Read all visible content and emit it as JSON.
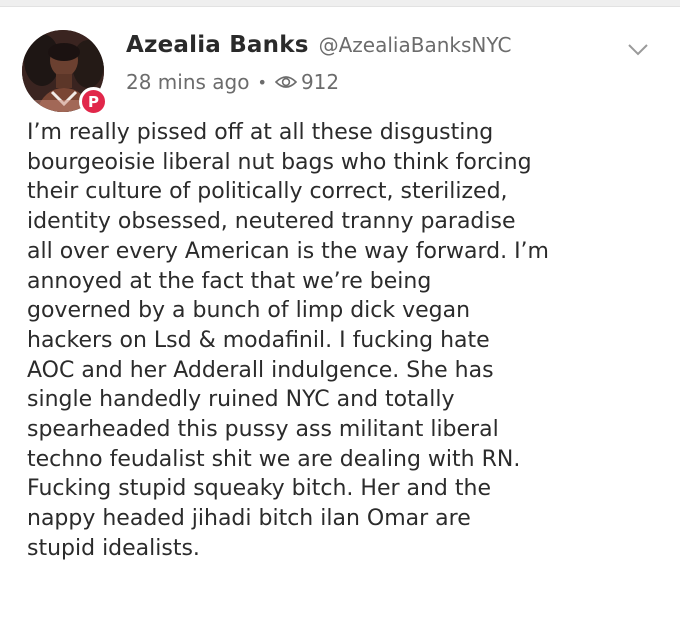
{
  "author": {
    "display_name": "Azealia Banks",
    "handle": "@AzealiaBanksNYC",
    "badge_letter": "P"
  },
  "meta": {
    "time": "28 mins ago",
    "separator": "•",
    "views": "912"
  },
  "post": {
    "lines": [
      "I’m really pissed off at all these disgusting",
      "bourgeoisie liberal nut bags who think forcing",
      "their culture of politically correct, sterilized,",
      "identity obsessed, neutered tranny paradise",
      "all over every American is the way forward. I’m",
      "annoyed at the fact that we’re being",
      "governed by a bunch of limp dick vegan",
      "hackers on Lsd & modafinil. I fucking hate",
      "AOC and her Adderall indulgence. She has",
      "single handedly ruined NYC and totally",
      "spearheaded this pussy ass militant liberal",
      "techno feudalist shit we are dealing with RN.",
      "Fucking stupid squeaky bitch. Her and the",
      "nappy headed jihadi bitch ilan Omar are",
      "stupid idealists."
    ]
  },
  "colors": {
    "badge": "#e1274a",
    "meta_text": "#6c6c6c",
    "body_text": "#2b2b2b"
  },
  "icons": {
    "badge": "parler-logo-icon",
    "views": "eye-icon",
    "menu": "chevron-down-icon"
  }
}
